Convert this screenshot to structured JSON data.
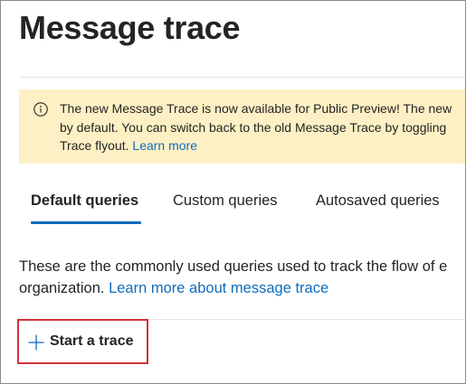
{
  "page": {
    "title": "Message trace"
  },
  "banner": {
    "icon": "info-icon",
    "line1": "The new Message Trace is now available for Public Preview! The new",
    "line2": "by default. You can switch back to the old Message Trace by toggling",
    "line3_text": "Trace flyout. ",
    "link": "Learn more",
    "background": "#fdf0c4"
  },
  "tabs": [
    {
      "label": "Default queries",
      "selected": true
    },
    {
      "label": "Custom queries",
      "selected": false
    },
    {
      "label": "Autosaved queries",
      "selected": false
    }
  ],
  "description": {
    "line1": "These are the commonly used queries used to track the flow of e",
    "line2_text": "organization. ",
    "link": "Learn more about message trace"
  },
  "actions": {
    "start_trace_label": "Start a trace",
    "start_trace_icon": "plus-icon",
    "highlight_color": "#d13438"
  },
  "colors": {
    "accent": "#0f6cbd",
    "text": "#242424"
  }
}
